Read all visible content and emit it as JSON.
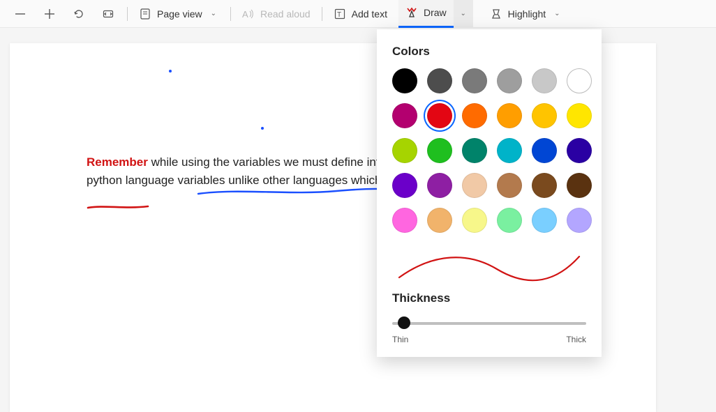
{
  "toolbar": {
    "page_view": "Page view",
    "read_aloud": "Read aloud",
    "add_text": "Add text",
    "draw": "Draw",
    "highlight": "Highlight"
  },
  "document": {
    "remember": "Remember",
    "body": " while using the variables we must define integer type in above example. It is python language variables unlike other languages which require to de variable."
  },
  "draw_panel": {
    "colors_title": "Colors",
    "thickness_title": "Thickness",
    "thin_label": "Thin",
    "thick_label": "Thick",
    "selected_color": "#e30613",
    "colors": [
      "#000000",
      "#4d4d4d",
      "#7a7a7a",
      "#9e9e9e",
      "#c8c8c8",
      "#ffffff",
      "#b3006f",
      "#e30613",
      "#ff6b00",
      "#ff9e00",
      "#ffc400",
      "#ffe600",
      "#a6d400",
      "#1fbf1f",
      "#00836a",
      "#00b3c9",
      "#0046d4",
      "#2a00a3",
      "#6b00c9",
      "#8e1fa3",
      "#f1c9a6",
      "#b37a4d",
      "#7a4a1e",
      "#5a3210",
      "#ff66e0",
      "#f1b36b",
      "#f7f78a",
      "#7af0a0",
      "#7acfff",
      "#b3a6ff"
    ]
  }
}
